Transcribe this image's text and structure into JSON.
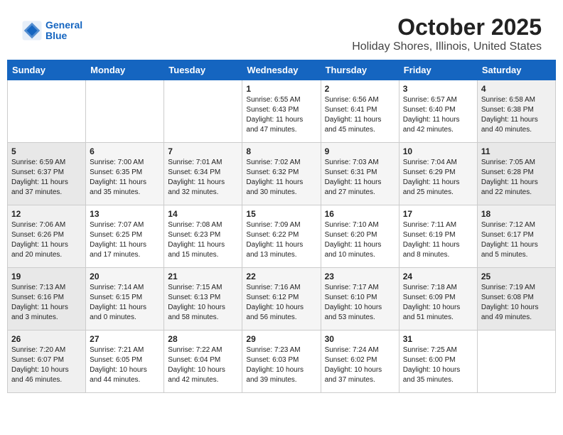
{
  "header": {
    "month_year": "October 2025",
    "location": "Holiday Shores, Illinois, United States",
    "logo_line1": "General",
    "logo_line2": "Blue"
  },
  "days_of_week": [
    "Sunday",
    "Monday",
    "Tuesday",
    "Wednesday",
    "Thursday",
    "Friday",
    "Saturday"
  ],
  "weeks": [
    [
      {
        "day": "",
        "info": ""
      },
      {
        "day": "",
        "info": ""
      },
      {
        "day": "",
        "info": ""
      },
      {
        "day": "1",
        "info": "Sunrise: 6:55 AM\nSunset: 6:43 PM\nDaylight: 11 hours\nand 47 minutes."
      },
      {
        "day": "2",
        "info": "Sunrise: 6:56 AM\nSunset: 6:41 PM\nDaylight: 11 hours\nand 45 minutes."
      },
      {
        "day": "3",
        "info": "Sunrise: 6:57 AM\nSunset: 6:40 PM\nDaylight: 11 hours\nand 42 minutes."
      },
      {
        "day": "4",
        "info": "Sunrise: 6:58 AM\nSunset: 6:38 PM\nDaylight: 11 hours\nand 40 minutes."
      }
    ],
    [
      {
        "day": "5",
        "info": "Sunrise: 6:59 AM\nSunset: 6:37 PM\nDaylight: 11 hours\nand 37 minutes."
      },
      {
        "day": "6",
        "info": "Sunrise: 7:00 AM\nSunset: 6:35 PM\nDaylight: 11 hours\nand 35 minutes."
      },
      {
        "day": "7",
        "info": "Sunrise: 7:01 AM\nSunset: 6:34 PM\nDaylight: 11 hours\nand 32 minutes."
      },
      {
        "day": "8",
        "info": "Sunrise: 7:02 AM\nSunset: 6:32 PM\nDaylight: 11 hours\nand 30 minutes."
      },
      {
        "day": "9",
        "info": "Sunrise: 7:03 AM\nSunset: 6:31 PM\nDaylight: 11 hours\nand 27 minutes."
      },
      {
        "day": "10",
        "info": "Sunrise: 7:04 AM\nSunset: 6:29 PM\nDaylight: 11 hours\nand 25 minutes."
      },
      {
        "day": "11",
        "info": "Sunrise: 7:05 AM\nSunset: 6:28 PM\nDaylight: 11 hours\nand 22 minutes."
      }
    ],
    [
      {
        "day": "12",
        "info": "Sunrise: 7:06 AM\nSunset: 6:26 PM\nDaylight: 11 hours\nand 20 minutes."
      },
      {
        "day": "13",
        "info": "Sunrise: 7:07 AM\nSunset: 6:25 PM\nDaylight: 11 hours\nand 17 minutes."
      },
      {
        "day": "14",
        "info": "Sunrise: 7:08 AM\nSunset: 6:23 PM\nDaylight: 11 hours\nand 15 minutes."
      },
      {
        "day": "15",
        "info": "Sunrise: 7:09 AM\nSunset: 6:22 PM\nDaylight: 11 hours\nand 13 minutes."
      },
      {
        "day": "16",
        "info": "Sunrise: 7:10 AM\nSunset: 6:20 PM\nDaylight: 11 hours\nand 10 minutes."
      },
      {
        "day": "17",
        "info": "Sunrise: 7:11 AM\nSunset: 6:19 PM\nDaylight: 11 hours\nand 8 minutes."
      },
      {
        "day": "18",
        "info": "Sunrise: 7:12 AM\nSunset: 6:17 PM\nDaylight: 11 hours\nand 5 minutes."
      }
    ],
    [
      {
        "day": "19",
        "info": "Sunrise: 7:13 AM\nSunset: 6:16 PM\nDaylight: 11 hours\nand 3 minutes."
      },
      {
        "day": "20",
        "info": "Sunrise: 7:14 AM\nSunset: 6:15 PM\nDaylight: 11 hours\nand 0 minutes."
      },
      {
        "day": "21",
        "info": "Sunrise: 7:15 AM\nSunset: 6:13 PM\nDaylight: 10 hours\nand 58 minutes."
      },
      {
        "day": "22",
        "info": "Sunrise: 7:16 AM\nSunset: 6:12 PM\nDaylight: 10 hours\nand 56 minutes."
      },
      {
        "day": "23",
        "info": "Sunrise: 7:17 AM\nSunset: 6:10 PM\nDaylight: 10 hours\nand 53 minutes."
      },
      {
        "day": "24",
        "info": "Sunrise: 7:18 AM\nSunset: 6:09 PM\nDaylight: 10 hours\nand 51 minutes."
      },
      {
        "day": "25",
        "info": "Sunrise: 7:19 AM\nSunset: 6:08 PM\nDaylight: 10 hours\nand 49 minutes."
      }
    ],
    [
      {
        "day": "26",
        "info": "Sunrise: 7:20 AM\nSunset: 6:07 PM\nDaylight: 10 hours\nand 46 minutes."
      },
      {
        "day": "27",
        "info": "Sunrise: 7:21 AM\nSunset: 6:05 PM\nDaylight: 10 hours\nand 44 minutes."
      },
      {
        "day": "28",
        "info": "Sunrise: 7:22 AM\nSunset: 6:04 PM\nDaylight: 10 hours\nand 42 minutes."
      },
      {
        "day": "29",
        "info": "Sunrise: 7:23 AM\nSunset: 6:03 PM\nDaylight: 10 hours\nand 39 minutes."
      },
      {
        "day": "30",
        "info": "Sunrise: 7:24 AM\nSunset: 6:02 PM\nDaylight: 10 hours\nand 37 minutes."
      },
      {
        "day": "31",
        "info": "Sunrise: 7:25 AM\nSunset: 6:00 PM\nDaylight: 10 hours\nand 35 minutes."
      },
      {
        "day": "",
        "info": ""
      }
    ]
  ]
}
